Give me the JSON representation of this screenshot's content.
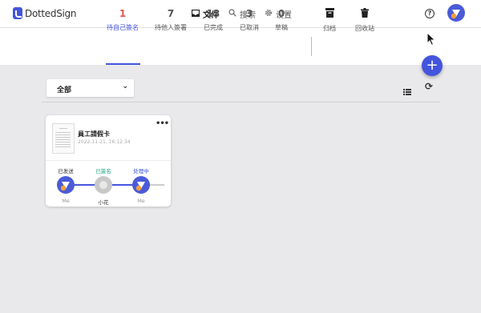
{
  "app": {
    "logo_text": "DottedSign"
  },
  "nav": [
    {
      "label": "文件",
      "icon": "inbox-icon"
    },
    {
      "label": "搜索",
      "icon": "search-icon"
    },
    {
      "label": "设置",
      "icon": "gear-icon"
    }
  ],
  "header": {
    "help_icon": "help-icon",
    "avatar": "user-avatar"
  },
  "status_tabs": [
    {
      "count": "1",
      "label": "待自己簽名",
      "active": true
    },
    {
      "count": "7",
      "label": "待他人簽署"
    },
    {
      "count": "13",
      "label": "已完成"
    },
    {
      "count": "3",
      "label": "已取消"
    },
    {
      "count": "0",
      "label": "草稿"
    }
  ],
  "folder_tabs": [
    {
      "label": "归档",
      "icon": "archive-icon"
    },
    {
      "label": "回收站",
      "icon": "trash-icon"
    }
  ],
  "toolbar": {
    "filter_value": "全部",
    "view_icon": "list-view-icon",
    "refresh_icon": "refresh-icon"
  },
  "fab": {
    "label": "+"
  },
  "document": {
    "title": "員工請假卡",
    "date": "2022-11-21, 16:12:34",
    "stages": [
      {
        "status": "已发送",
        "status_color": "#333333",
        "name": "Me"
      },
      {
        "status": "已簽名",
        "status_color": "#1fa37a",
        "name": "小花"
      },
      {
        "status": "处理中",
        "status_color": "#3a4fd6",
        "name": "Me"
      }
    ]
  },
  "colors": {
    "accent": "#4455dd",
    "active_count": "#e05a4a",
    "signed": "#1fa37a"
  }
}
